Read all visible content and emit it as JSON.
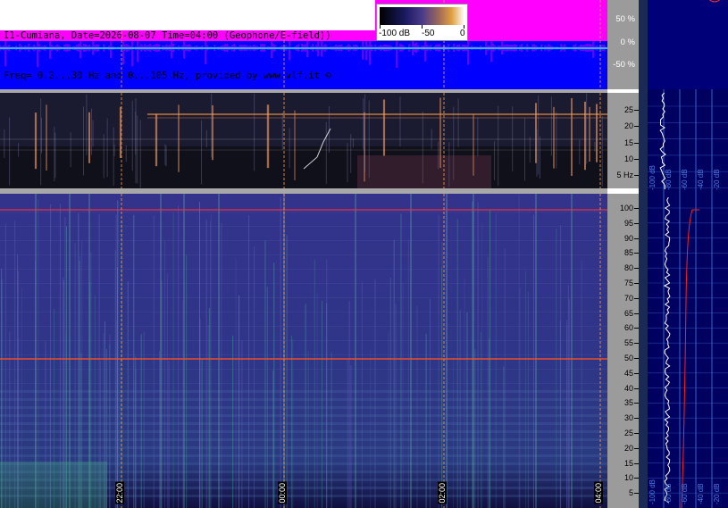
{
  "header": {
    "line1": "I1-Cumiana, Date=2026-08-07 Time=04:00 (Geophone/E-field))",
    "line2": "Freq= 0.2...30 Hz and 0...105 Hz, provided by www.vlf.it ©"
  },
  "colorbar": {
    "labels": [
      "-100 dB",
      "-50",
      "0"
    ]
  },
  "amplitude_axis": {
    "labels": [
      "50 %",
      "0 %",
      "-50 %"
    ]
  },
  "top_axis": {
    "labels": [
      "25",
      "20",
      "15",
      "10",
      "5 Hz"
    ]
  },
  "bottom_axis": {
    "labels": [
      "100",
      "95",
      "90",
      "85",
      "80",
      "75",
      "70",
      "65",
      "60",
      "55",
      "50",
      "45",
      "40",
      "35",
      "30",
      "25",
      "20",
      "15",
      "10",
      "5"
    ]
  },
  "time_labels": [
    "22:00",
    "00:00",
    "02:00",
    "04:00"
  ],
  "profile_labels": {
    "top": [
      "-100 dB",
      "-80 dB",
      "-60 dB",
      "-40 dB",
      "-20 dB"
    ],
    "bottom": [
      "-100 dB",
      "-80 dB",
      "-60 dB",
      "-40 dB",
      "-20 dB"
    ]
  },
  "colors": {
    "amp_background": "#0000ff",
    "amp_trace": "#ff00ff",
    "zero_line": "#00ffff",
    "spectrogram_bg": "#2a2a8a",
    "marker_line": "#ffa040",
    "profile_bg": "#000060",
    "profile_grid": "#3c6fd0",
    "mains_line": "#ff3030"
  },
  "icons": [
    "copyright-symbol"
  ]
}
